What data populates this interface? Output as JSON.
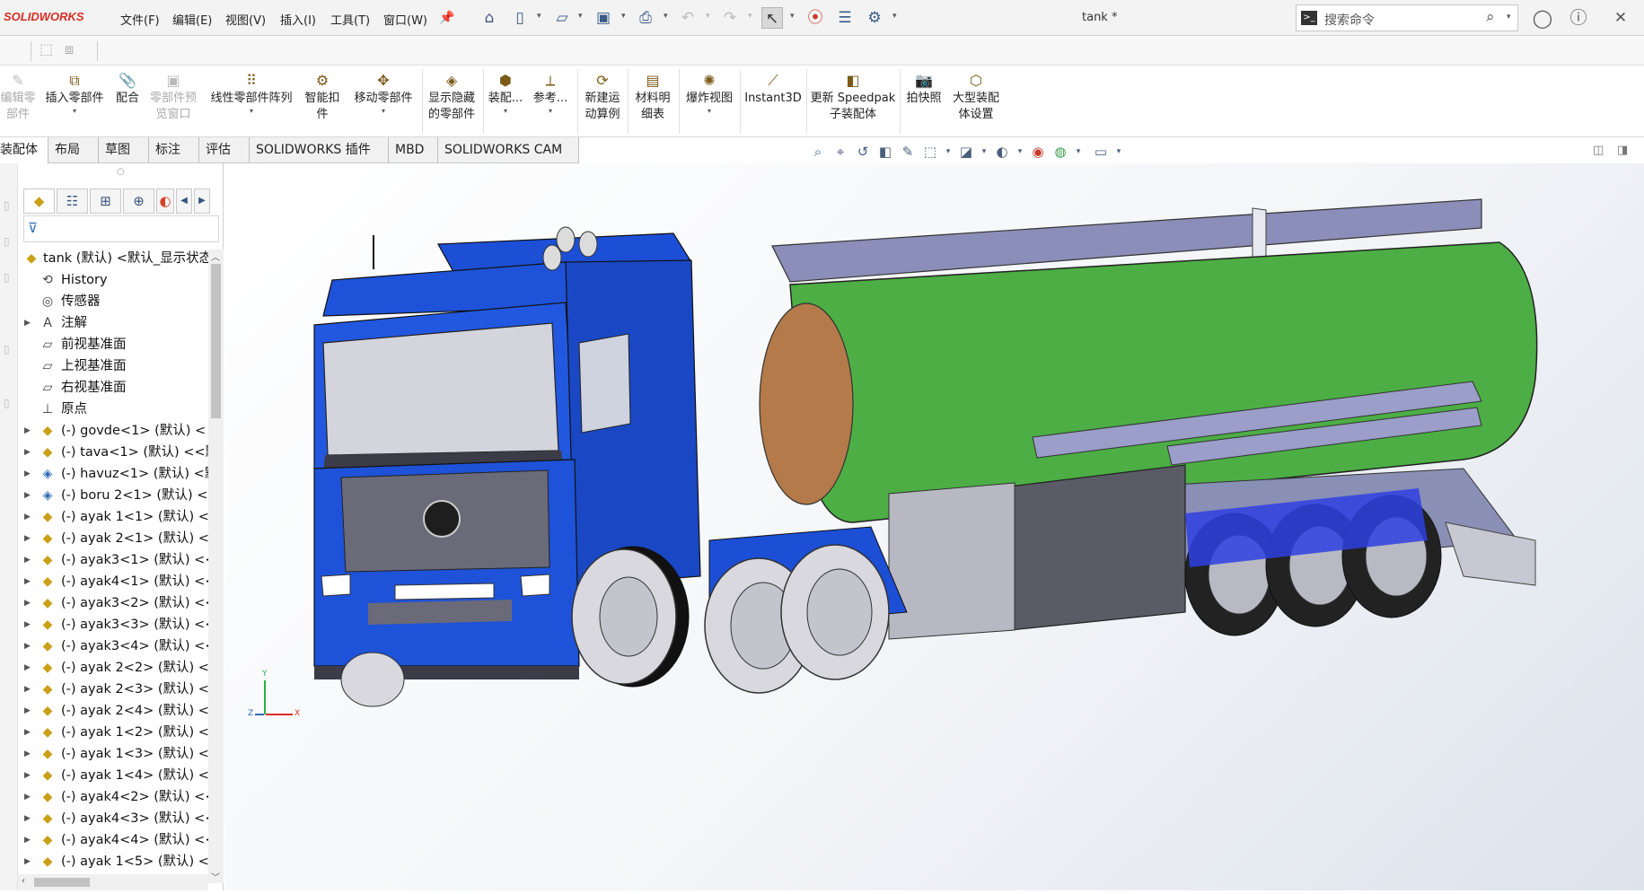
{
  "app": {
    "brand": "SOLIDWORKS",
    "document_title": "tank *"
  },
  "menu": [
    "文件(F)",
    "编辑(E)",
    "视图(V)",
    "插入(I)",
    "工具(T)",
    "窗口(W)"
  ],
  "search": {
    "placeholder": "搜索命令"
  },
  "commands": [
    {
      "label": "编辑零部件",
      "icon": "edit-component-icon",
      "enabled": false
    },
    {
      "label": "插入零部件",
      "icon": "insert-components-icon",
      "enabled": true
    },
    {
      "label": "配合",
      "icon": "mate-icon",
      "enabled": true
    },
    {
      "label": "零部件预览窗口",
      "icon": "component-preview-icon",
      "enabled": false
    },
    {
      "label": "线性零部件阵列",
      "icon": "linear-pattern-icon",
      "enabled": true
    },
    {
      "label": "智能扣件",
      "icon": "smart-fasteners-icon",
      "enabled": true
    },
    {
      "label": "移动零部件",
      "icon": "move-component-icon",
      "enabled": true
    },
    {
      "label": "显示隐藏的零部件",
      "icon": "show-hidden-icon",
      "enabled": true
    },
    {
      "label": "装配...",
      "icon": "assembly-features-icon",
      "enabled": true
    },
    {
      "label": "参考...",
      "icon": "reference-geometry-icon",
      "enabled": true
    },
    {
      "label": "新建运动算例",
      "icon": "new-motion-study-icon",
      "enabled": true
    },
    {
      "label": "材料明细表",
      "icon": "bom-icon",
      "enabled": true
    },
    {
      "label": "爆炸视图",
      "icon": "exploded-view-icon",
      "enabled": true
    },
    {
      "label": "Instant3D",
      "icon": "instant3d-icon",
      "enabled": true
    },
    {
      "label": "更新 Speedpak 子装配体",
      "icon": "speedpak-icon",
      "enabled": true
    },
    {
      "label": "拍快照",
      "icon": "snapshot-icon",
      "enabled": true
    },
    {
      "label": "大型装配体设置",
      "icon": "large-assembly-icon",
      "enabled": true
    }
  ],
  "tabs": [
    "装配体",
    "布局",
    "草图",
    "标注",
    "评估",
    "SOLIDWORKS 插件",
    "MBD",
    "SOLIDWORKS CAM"
  ],
  "active_tab": "装配体",
  "tree": [
    {
      "label": "tank (默认) <默认_显示状态",
      "icon": "assembly-icon",
      "expand": ""
    },
    {
      "label": "History",
      "icon": "history-icon",
      "expand": ""
    },
    {
      "label": "传感器",
      "icon": "sensor-icon",
      "expand": ""
    },
    {
      "label": "注解",
      "icon": "annotation-icon",
      "expand": "▶"
    },
    {
      "label": "前视基准面",
      "icon": "plane-icon",
      "expand": ""
    },
    {
      "label": "上视基准面",
      "icon": "plane-icon",
      "expand": ""
    },
    {
      "label": "右视基准面",
      "icon": "plane-icon",
      "expand": ""
    },
    {
      "label": "原点",
      "icon": "origin-icon",
      "expand": ""
    },
    {
      "label": "(-) govde<1> (默认) <",
      "icon": "part-icon",
      "expand": "▶"
    },
    {
      "label": "(-) tava<1> (默认) <<默",
      "icon": "part-icon",
      "expand": "▶"
    },
    {
      "label": "(-) havuz<1> (默认) <默",
      "icon": "subassembly-icon",
      "expand": "▶"
    },
    {
      "label": "(-) boru 2<1> (默认) <",
      "icon": "subassembly-icon",
      "expand": "▶"
    },
    {
      "label": "(-) ayak 1<1> (默认) <",
      "icon": "part-icon",
      "expand": "▶"
    },
    {
      "label": "(-) ayak 2<1> (默认) <",
      "icon": "part-icon",
      "expand": "▶"
    },
    {
      "label": "(-) ayak3<1> (默认) <<",
      "icon": "part-icon",
      "expand": "▶"
    },
    {
      "label": "(-) ayak4<1> (默认) <<",
      "icon": "part-icon",
      "expand": "▶"
    },
    {
      "label": "(-) ayak3<2> (默认) <<",
      "icon": "part-icon",
      "expand": "▶"
    },
    {
      "label": "(-) ayak3<3> (默认) <<",
      "icon": "part-icon",
      "expand": "▶"
    },
    {
      "label": "(-) ayak3<4> (默认) <<",
      "icon": "part-icon",
      "expand": "▶"
    },
    {
      "label": "(-) ayak 2<2> (默认) <",
      "icon": "part-icon",
      "expand": "▶"
    },
    {
      "label": "(-) ayak 2<3> (默认) <",
      "icon": "part-icon",
      "expand": "▶"
    },
    {
      "label": "(-) ayak 2<4> (默认) <",
      "icon": "part-icon",
      "expand": "▶"
    },
    {
      "label": "(-) ayak 1<2> (默认) <",
      "icon": "part-icon",
      "expand": "▶"
    },
    {
      "label": "(-) ayak 1<3> (默认) <",
      "icon": "part-icon",
      "expand": "▶"
    },
    {
      "label": "(-) ayak 1<4> (默认) <",
      "icon": "part-icon",
      "expand": "▶"
    },
    {
      "label": "(-) ayak4<2> (默认) <<",
      "icon": "part-icon",
      "expand": "▶"
    },
    {
      "label": "(-) ayak4<3> (默认) <<",
      "icon": "part-icon",
      "expand": "▶"
    },
    {
      "label": "(-) ayak4<4> (默认) <<",
      "icon": "part-icon",
      "expand": "▶"
    },
    {
      "label": "(-) ayak 1<5> (默认) <",
      "icon": "part-icon",
      "expand": "▶"
    }
  ],
  "triad": {
    "x": "X",
    "y": "Y",
    "z": "Z"
  },
  "colors": {
    "cab": "#1c4fd6",
    "tank": "#4cae44",
    "accent": "#d62e24",
    "panel_bg": "#f3f3f3"
  }
}
